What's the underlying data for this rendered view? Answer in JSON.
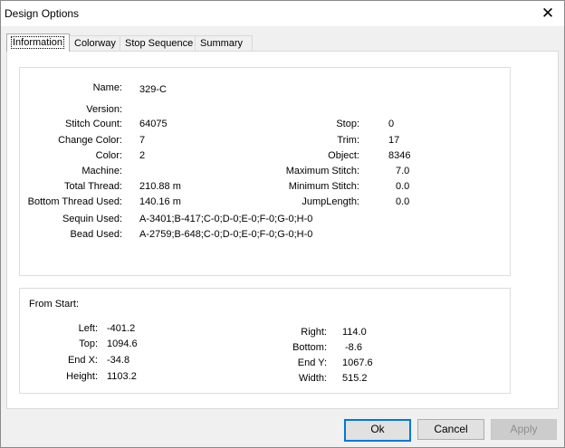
{
  "dialog": {
    "title": "Design Options",
    "close_glyph": "✕"
  },
  "tabs": [
    {
      "label": "Information",
      "active": true
    },
    {
      "label": "Colorway",
      "active": false
    },
    {
      "label": "Stop Sequence",
      "active": false
    },
    {
      "label": "Summary",
      "active": false
    }
  ],
  "info": {
    "name_label": "Name:",
    "name_value": "329-C",
    "version_label": "Version:",
    "version_value": "",
    "stitch_count_label": "Stitch Count:",
    "stitch_count_value": "64075",
    "change_color_label": "Change Color:",
    "change_color_value": "7",
    "color_label": "Color:",
    "color_value": "2",
    "machine_label": "Machine:",
    "machine_value": "",
    "total_thread_label": "Total Thread:",
    "total_thread_value": "210.88 m",
    "bottom_thread_label": "Bottom Thread Used:",
    "bottom_thread_value": "140.16 m",
    "sequin_label": "Sequin Used:",
    "sequin_value": "A-3401;B-417;C-0;D-0;E-0;F-0;G-0;H-0",
    "bead_label": "Bead Used:",
    "bead_value": "A-2759;B-648;C-0;D-0;E-0;F-0;G-0;H-0",
    "stop_label": "Stop:",
    "stop_value": "0",
    "trim_label": "Trim:",
    "trim_value": "17",
    "object_label": "Object:",
    "object_value": "8346",
    "max_stitch_label": "Maximum Stitch:",
    "max_stitch_value": "7.0",
    "min_stitch_label": "Minimum Stitch:",
    "min_stitch_value": "0.0",
    "jump_length_label": "JumpLength:",
    "jump_length_value": "0.0"
  },
  "from_start": {
    "heading": "From Start:",
    "left_label": "Left:",
    "left_value": "-401.2",
    "top_label": "Top:",
    "top_value": "1094.6",
    "end_x_label": "End X:",
    "end_x_value": "-34.8",
    "height_label": "Height:",
    "height_value": "1103.2",
    "right_label": "Right:",
    "right_value": "114.0",
    "bottom_label": "Bottom:",
    "bottom_value": "-8.6",
    "end_y_label": "End Y:",
    "end_y_value": "1067.6",
    "width_label": "Width:",
    "width_value": "515.2"
  },
  "buttons": {
    "ok": "Ok",
    "cancel": "Cancel",
    "apply": "Apply"
  }
}
